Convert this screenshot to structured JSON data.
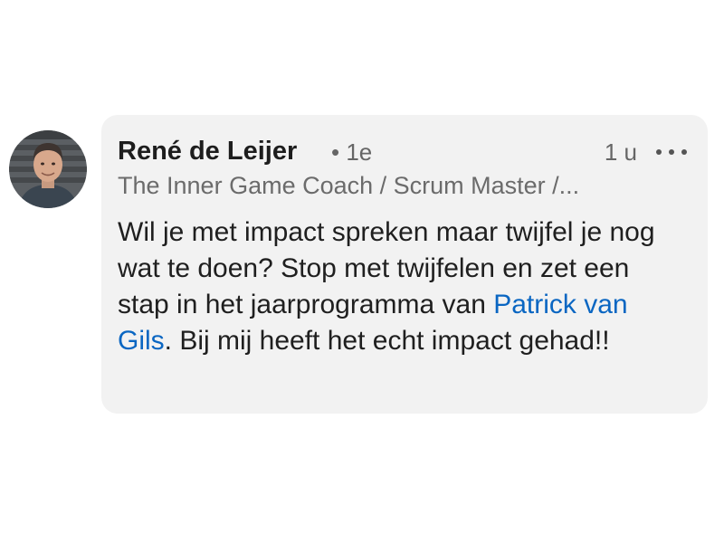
{
  "comment": {
    "author": {
      "name": "René de Leijer",
      "degree": "• 1e",
      "headline": "The Inner Game Coach / Scrum Master /..."
    },
    "timestamp": "1 u",
    "more_icon": "ellipsis-icon",
    "body": {
      "text_before": "Wil je met impact spreken maar twijfel je nog wat te doen? Stop met twijfelen en zet een stap in het jaarprogramma van ",
      "mention": "Patrick van Gils",
      "text_after": ". Bij mij heeft het echt impact gehad!!"
    },
    "colors": {
      "bubble": "#f2f2f2",
      "mention": "#0a66c2",
      "muted": "#666666"
    }
  }
}
